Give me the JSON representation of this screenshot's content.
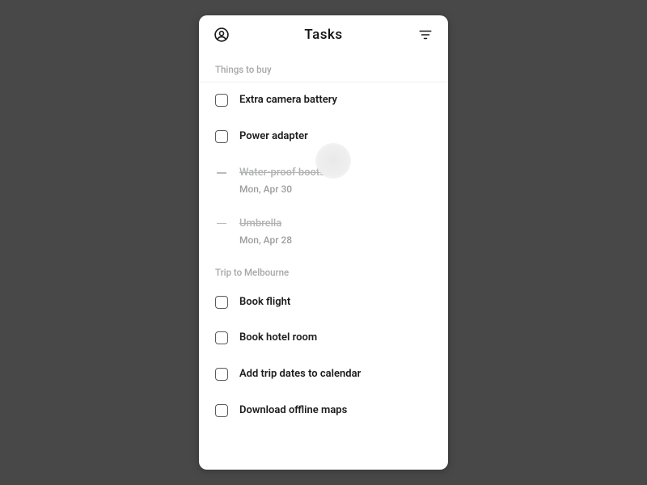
{
  "header": {
    "title": "Tasks"
  },
  "sections": [
    {
      "title": "Things to buy",
      "tasks": [
        {
          "label": "Extra camera battery",
          "completed": false,
          "date": null
        },
        {
          "label": "Power adapter",
          "completed": false,
          "date": null
        },
        {
          "label": "Water-proof boots",
          "completed": true,
          "date": "Mon, Apr 30"
        },
        {
          "label": "Umbrella",
          "completed": true,
          "date": "Mon, Apr 28"
        }
      ]
    },
    {
      "title": "Trip to Melbourne",
      "tasks": [
        {
          "label": "Book flight",
          "completed": false,
          "date": null
        },
        {
          "label": "Book hotel room",
          "completed": false,
          "date": null
        },
        {
          "label": "Add trip dates to calendar",
          "completed": false,
          "date": null
        },
        {
          "label": "Download offline maps",
          "completed": false,
          "date": null
        }
      ]
    }
  ]
}
